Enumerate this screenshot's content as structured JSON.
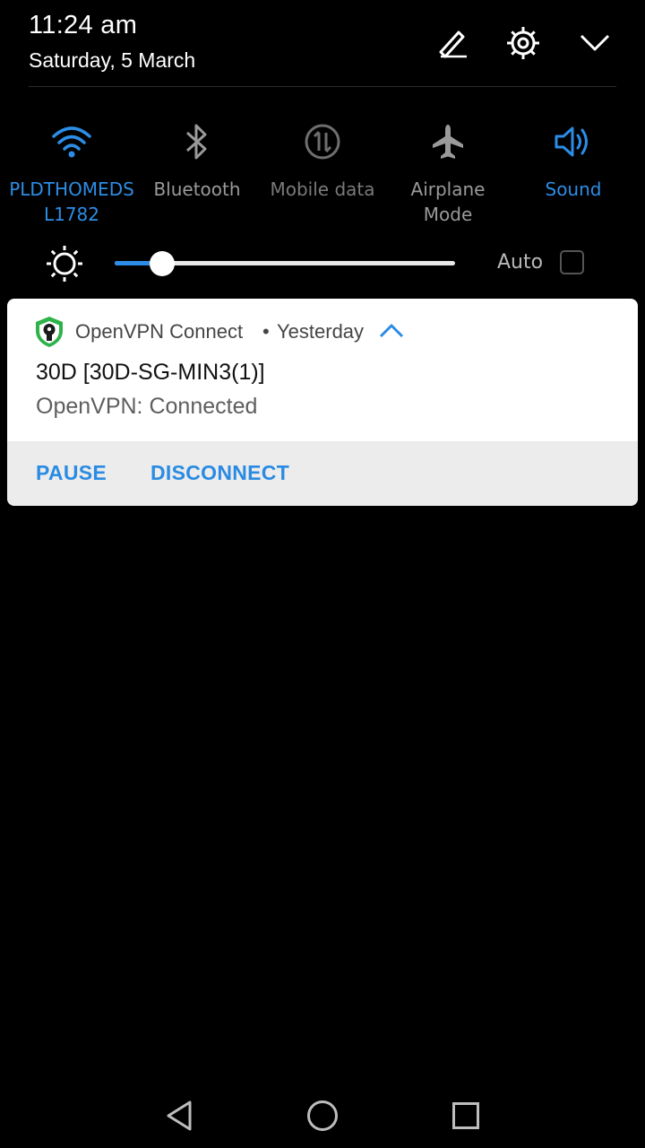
{
  "status": {
    "time": "11:24 am",
    "date": "Saturday, 5 March"
  },
  "header_icons": {
    "edit": "edit-pencil-icon",
    "settings": "gear-icon",
    "collapse": "chevron-down-icon"
  },
  "toggles": [
    {
      "label": "PLDTHOMEDS\nL1782",
      "icon": "wifi-icon",
      "state": "on",
      "color": "#2d8de6"
    },
    {
      "label": "Bluetooth",
      "icon": "bluetooth-icon",
      "state": "off",
      "color": "#9a9a9a"
    },
    {
      "label": "Mobile data",
      "icon": "mobile-data-icon",
      "state": "disabled",
      "color": "#7a7a7a"
    },
    {
      "label": "Airplane Mode",
      "icon": "airplane-icon",
      "state": "off",
      "color": "#9a9a9a"
    },
    {
      "label": "Sound",
      "icon": "speaker-icon",
      "state": "on",
      "color": "#2d8de6"
    }
  ],
  "brightness": {
    "level": 0.14,
    "auto_label": "Auto",
    "auto_checked": false
  },
  "notification": {
    "app_name": "OpenVPN Connect",
    "separator": "•",
    "time": "Yesterday",
    "title": "30D [30D-SG-MIN3(1)]",
    "text": "OpenVPN: Connected",
    "actions": [
      "PAUSE",
      "DISCONNECT"
    ],
    "accent": "#2a8be3"
  },
  "navbar": {
    "back": "back-triangle-icon",
    "home": "home-circle-icon",
    "recents": "recents-square-icon"
  }
}
